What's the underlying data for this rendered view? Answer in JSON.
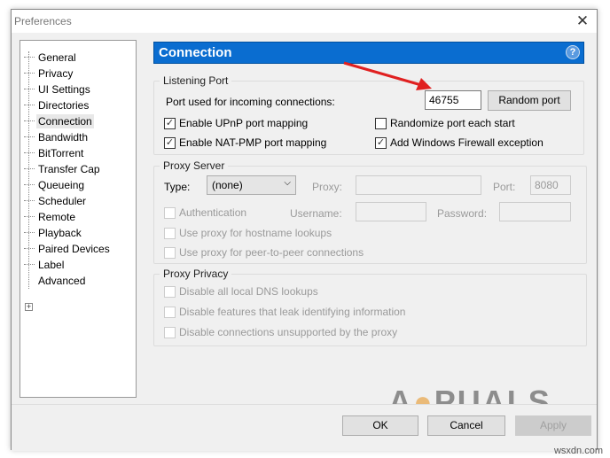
{
  "window": {
    "title": "Preferences",
    "close": "✕"
  },
  "sidebar": {
    "items": [
      "General",
      "Privacy",
      "UI Settings",
      "Directories",
      "Connection",
      "Bandwidth",
      "BitTorrent",
      "Transfer Cap",
      "Queueing",
      "Scheduler",
      "Remote",
      "Playback",
      "Paired Devices",
      "Label",
      "Advanced"
    ],
    "selected": "Connection",
    "expand": "+"
  },
  "header": {
    "title": "Connection",
    "help": "?",
    "color": "#0a6dd0"
  },
  "listening": {
    "title": "Listening Port",
    "port_label": "Port used for incoming connections:",
    "port_value": "46755",
    "random_button": "Random port",
    "upnp": {
      "label": "Enable UPnP port mapping",
      "checked": true
    },
    "natpmp": {
      "label": "Enable NAT-PMP port mapping",
      "checked": true
    },
    "randomize": {
      "label": "Randomize port each start",
      "checked": false
    },
    "firewall": {
      "label": "Add Windows Firewall exception",
      "checked": true
    }
  },
  "proxy": {
    "title": "Proxy Server",
    "type_label": "Type:",
    "type_value": "(none)",
    "proxy_label": "Proxy:",
    "port_label": "Port:",
    "port_value": "8080",
    "auth": "Authentication",
    "username_label": "Username:",
    "password_label": "Password:",
    "hostname": "Use proxy for hostname lookups",
    "p2p": "Use proxy for peer-to-peer connections"
  },
  "privacy": {
    "title": "Proxy Privacy",
    "dns": "Disable all local DNS lookups",
    "leak": "Disable features that leak identifying information",
    "unsupported": "Disable connections unsupported by the proxy"
  },
  "buttons": {
    "ok": "OK",
    "cancel": "Cancel",
    "apply": "Apply"
  },
  "watermark": {
    "logo": "APPUALS",
    "site": "wsxdn.com"
  }
}
